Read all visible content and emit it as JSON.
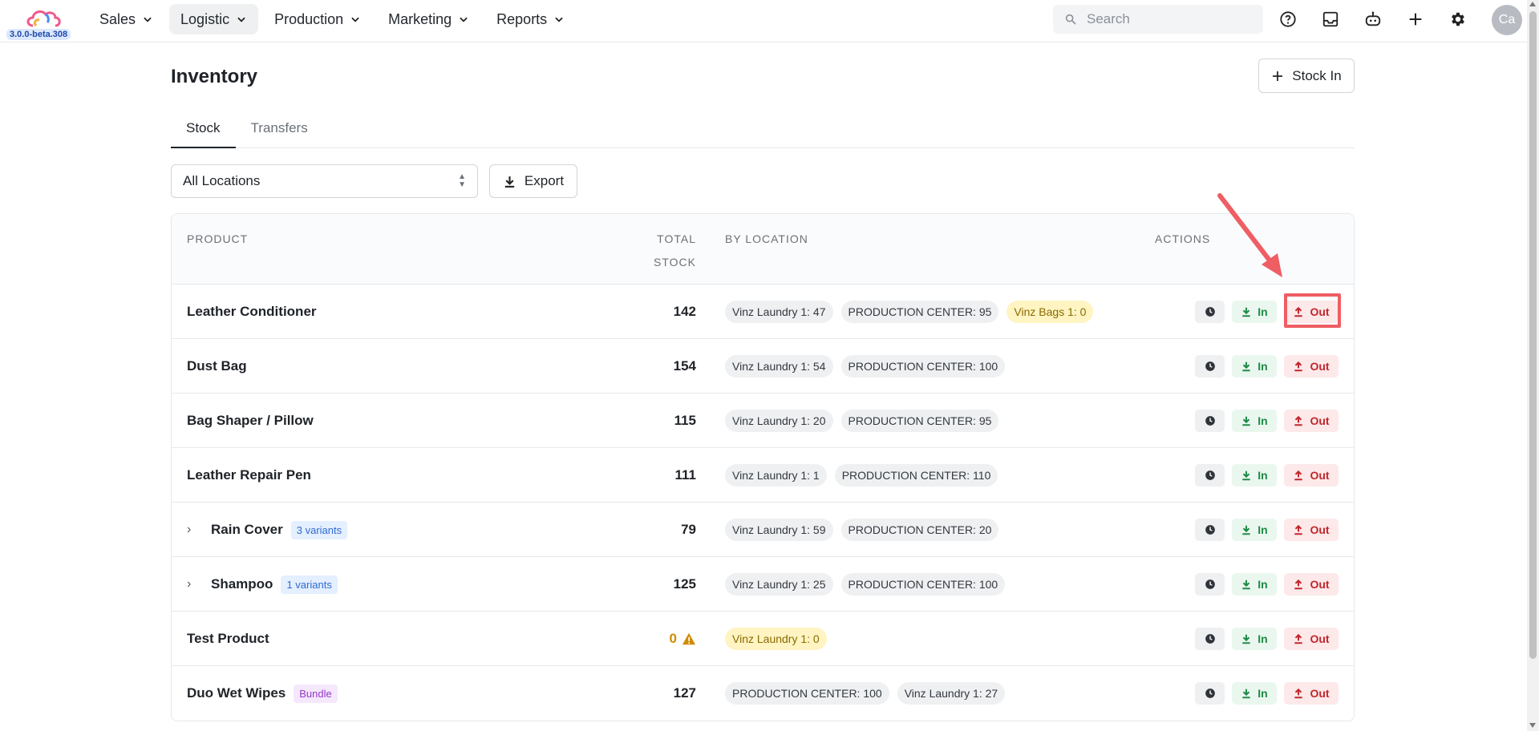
{
  "app": {
    "version": "3.0.0-beta.308",
    "avatar_initials": "Ca"
  },
  "nav": {
    "items": [
      {
        "label": "Sales",
        "active": false
      },
      {
        "label": "Logistic",
        "active": true
      },
      {
        "label": "Production",
        "active": false
      },
      {
        "label": "Marketing",
        "active": false
      },
      {
        "label": "Reports",
        "active": false
      }
    ],
    "search_placeholder": "Search",
    "icons": [
      "help-icon",
      "inbox-icon",
      "bot-icon",
      "plus-icon",
      "gear-icon"
    ]
  },
  "page": {
    "title": "Inventory",
    "stock_in_label": "Stock In",
    "tabs": [
      {
        "label": "Stock",
        "active": true
      },
      {
        "label": "Transfers",
        "active": false
      }
    ],
    "location_filter": "All Locations",
    "export_label": "Export"
  },
  "table": {
    "headers": {
      "product": "PRODUCT",
      "total_line1": "TOTAL",
      "total_line2": "STOCK",
      "by_location": "BY LOCATION",
      "actions": "ACTIONS"
    },
    "action_labels": {
      "in": "In",
      "out": "Out"
    },
    "rows": [
      {
        "product": "Leather Conditioner",
        "expandable": false,
        "badge": "",
        "total": "142",
        "warning": false,
        "locations": [
          {
            "text": "Vinz Laundry 1: 47",
            "zero": false
          },
          {
            "text": "PRODUCTION CENTER: 95",
            "zero": false
          },
          {
            "text": "Vinz Bags 1: 0",
            "zero": true
          }
        ]
      },
      {
        "product": "Dust Bag",
        "expandable": false,
        "badge": "",
        "total": "154",
        "warning": false,
        "locations": [
          {
            "text": "Vinz Laundry 1: 54",
            "zero": false
          },
          {
            "text": "PRODUCTION CENTER: 100",
            "zero": false
          }
        ]
      },
      {
        "product": "Bag Shaper / Pillow",
        "expandable": false,
        "badge": "",
        "total": "115",
        "warning": false,
        "locations": [
          {
            "text": "Vinz Laundry 1: 20",
            "zero": false
          },
          {
            "text": "PRODUCTION CENTER: 95",
            "zero": false
          }
        ]
      },
      {
        "product": "Leather Repair Pen",
        "expandable": false,
        "badge": "",
        "total": "111",
        "warning": false,
        "locations": [
          {
            "text": "Vinz Laundry 1: 1",
            "zero": false
          },
          {
            "text": "PRODUCTION CENTER: 110",
            "zero": false
          }
        ]
      },
      {
        "product": "Rain Cover",
        "expandable": true,
        "badge": "3 variants",
        "badge_type": "variant",
        "total": "79",
        "warning": false,
        "locations": [
          {
            "text": "Vinz Laundry 1: 59",
            "zero": false
          },
          {
            "text": "PRODUCTION CENTER: 20",
            "zero": false
          }
        ]
      },
      {
        "product": "Shampoo",
        "expandable": true,
        "badge": "1 variants",
        "badge_type": "variant",
        "total": "125",
        "warning": false,
        "locations": [
          {
            "text": "Vinz Laundry 1: 25",
            "zero": false
          },
          {
            "text": "PRODUCTION CENTER: 100",
            "zero": false
          }
        ]
      },
      {
        "product": "Test Product",
        "expandable": false,
        "badge": "",
        "total": "0",
        "warning": true,
        "locations": [
          {
            "text": "Vinz Laundry 1: 0",
            "zero": true
          }
        ]
      },
      {
        "product": "Duo Wet Wipes",
        "expandable": false,
        "badge": "Bundle",
        "badge_type": "bundle",
        "total": "127",
        "warning": false,
        "locations": [
          {
            "text": "PRODUCTION CENTER: 100",
            "zero": false
          },
          {
            "text": "Vinz Laundry 1: 27",
            "zero": false
          }
        ]
      }
    ]
  },
  "colors": {
    "accent_annotation": "#ee5e63",
    "in_green": "#1f8a47",
    "out_red": "#c0262d",
    "warning": "#d08b00"
  }
}
